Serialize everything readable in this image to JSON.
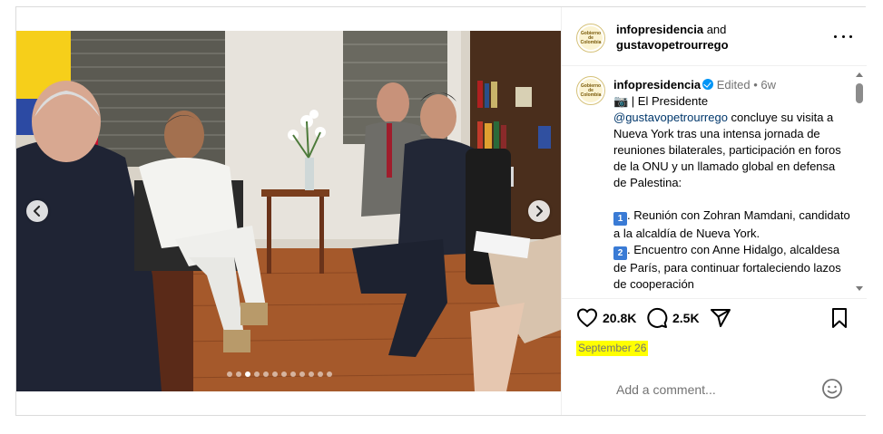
{
  "header": {
    "account": "infopresidencia",
    "joiner": "and",
    "collaborator": "gustavopetrourrego",
    "avatar_text": "Gobierno de Colombia"
  },
  "caption": {
    "username": "infopresidencia",
    "edited": "Edited",
    "separator": "•",
    "age": "6w",
    "camera_emoji": "📷",
    "line_intro": " | El Presidente",
    "mention": "@gustavopetrourrego",
    "line_body": " concluye su visita a Nueva York tras una intensa jornada de reuniones bilaterales, participación en foros de la ONU y un llamado global en defensa de Palestina:",
    "item1_num": "1",
    "item1_text": ". Reunión con Zohran Mamdani, candidato a la alcaldía de Nueva York.",
    "item2_num": "2",
    "item2_text": ". Encuentro con Anne Hidalgo, alcaldesa de París, para continuar fortaleciendo lazos de cooperación"
  },
  "actions": {
    "like_count": "20.8K",
    "comment_count": "2.5K"
  },
  "date": "September 26",
  "comment_box": {
    "placeholder": "Add a comment..."
  },
  "carousel": {
    "slide_count": 12,
    "active_index": 2
  },
  "icons": {
    "prev": "chevron-left-icon",
    "next": "chevron-right-icon",
    "more": "more-horizontal-icon",
    "like": "heart-icon",
    "comment": "comment-bubble-icon",
    "share": "send-icon",
    "save": "bookmark-icon",
    "emoji": "emoji-smile-icon",
    "verified": "verified-badge-icon"
  },
  "colors": {
    "verified_blue": "#0095f6",
    "mention_blue": "#00376b",
    "muted_gray": "#737373",
    "date_highlight": "#ffff00"
  }
}
